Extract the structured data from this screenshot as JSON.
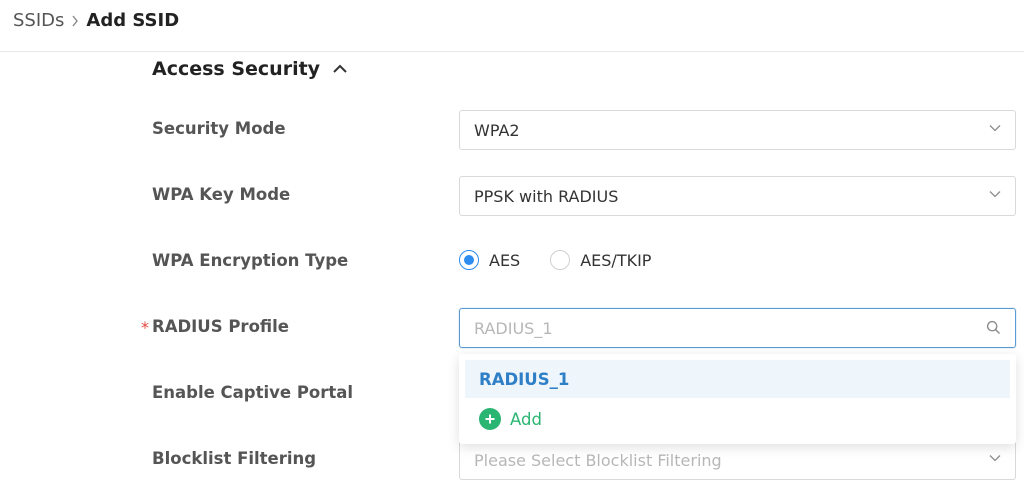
{
  "breadcrumb": {
    "root": "SSIDs",
    "current": "Add SSID"
  },
  "section": {
    "title": "Access Security"
  },
  "fields": {
    "security_mode": {
      "label": "Security Mode",
      "value": "WPA2"
    },
    "wpa_key_mode": {
      "label": "WPA Key Mode",
      "value": "PPSK with RADIUS"
    },
    "encryption": {
      "label": "WPA Encryption Type",
      "options": [
        "AES",
        "AES/TKIP"
      ],
      "selected": "AES"
    },
    "radius_profile": {
      "label": "RADIUS Profile",
      "required": "*",
      "placeholder": "RADIUS_1"
    },
    "captive_portal": {
      "label": "Enable Captive Portal"
    },
    "blocklist": {
      "label": "Blocklist Filtering",
      "placeholder": "Please Select Blocklist Filtering"
    }
  },
  "dropdown": {
    "items": [
      "RADIUS_1"
    ],
    "add_label": "Add"
  },
  "icons": {
    "breadcrumb_separator": "chevron-right-icon",
    "section_toggle": "chevron-up-icon",
    "select_arrow": "chevron-down-icon",
    "search": "search-icon",
    "add": "plus-circle-icon"
  },
  "colors": {
    "accent": "#2f8cf0",
    "success": "#2bb573",
    "required": "#e0483e"
  }
}
